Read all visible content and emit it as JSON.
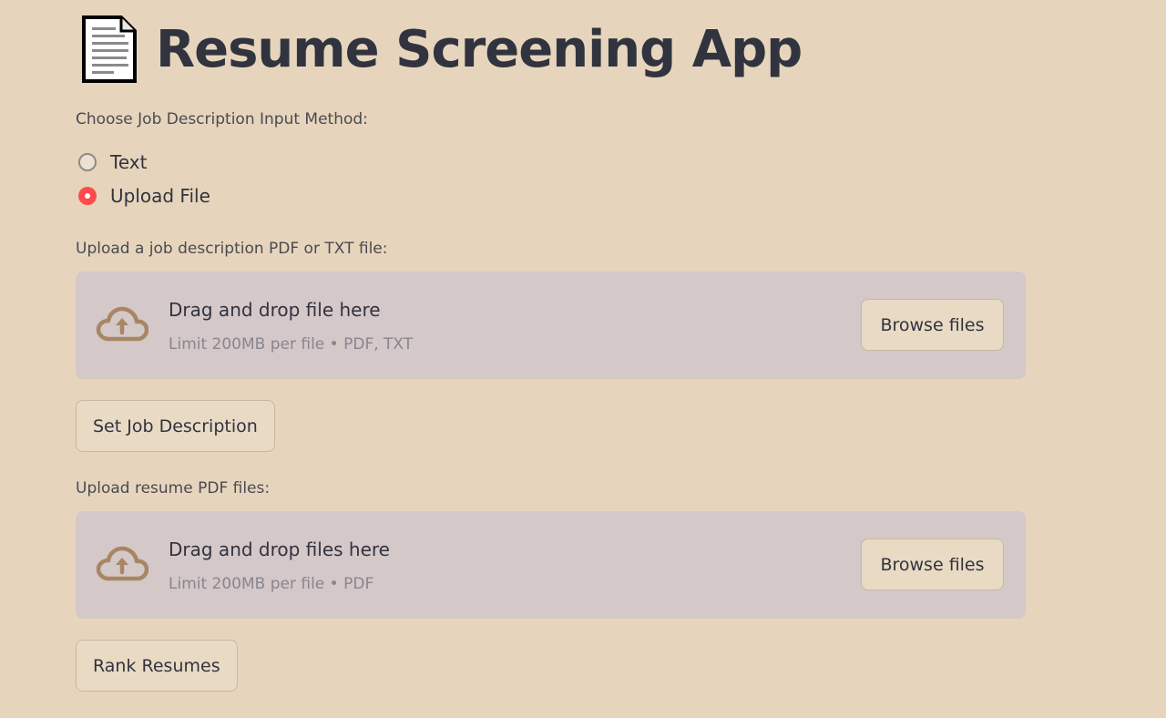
{
  "app": {
    "title": "Resume Screening App",
    "title_icon": "page-document-icon"
  },
  "job_description": {
    "method_label": "Choose Job Description Input Method:",
    "options": [
      {
        "label": "Text",
        "selected": false
      },
      {
        "label": "Upload File",
        "selected": true
      }
    ],
    "upload_label": "Upload a job description PDF or TXT file:",
    "dropzone": {
      "icon": "cloud-upload-icon",
      "main_text": "Drag and drop file here",
      "limit_text": "Limit 200MB per file • PDF, TXT",
      "browse_label": "Browse files"
    },
    "set_button_label": "Set Job Description"
  },
  "resumes": {
    "upload_label": "Upload resume PDF files:",
    "dropzone": {
      "icon": "cloud-upload-icon",
      "main_text": "Drag and drop files here",
      "limit_text": "Limit 200MB per file • PDF",
      "browse_label": "Browse files"
    },
    "rank_button_label": "Rank Resumes"
  },
  "colors": {
    "background": "#e6d5bc",
    "dropzone": "#d4c8c8",
    "accent_radio": "#ff4b4b",
    "icon_brown": "#a88663",
    "text": "#31333f"
  }
}
